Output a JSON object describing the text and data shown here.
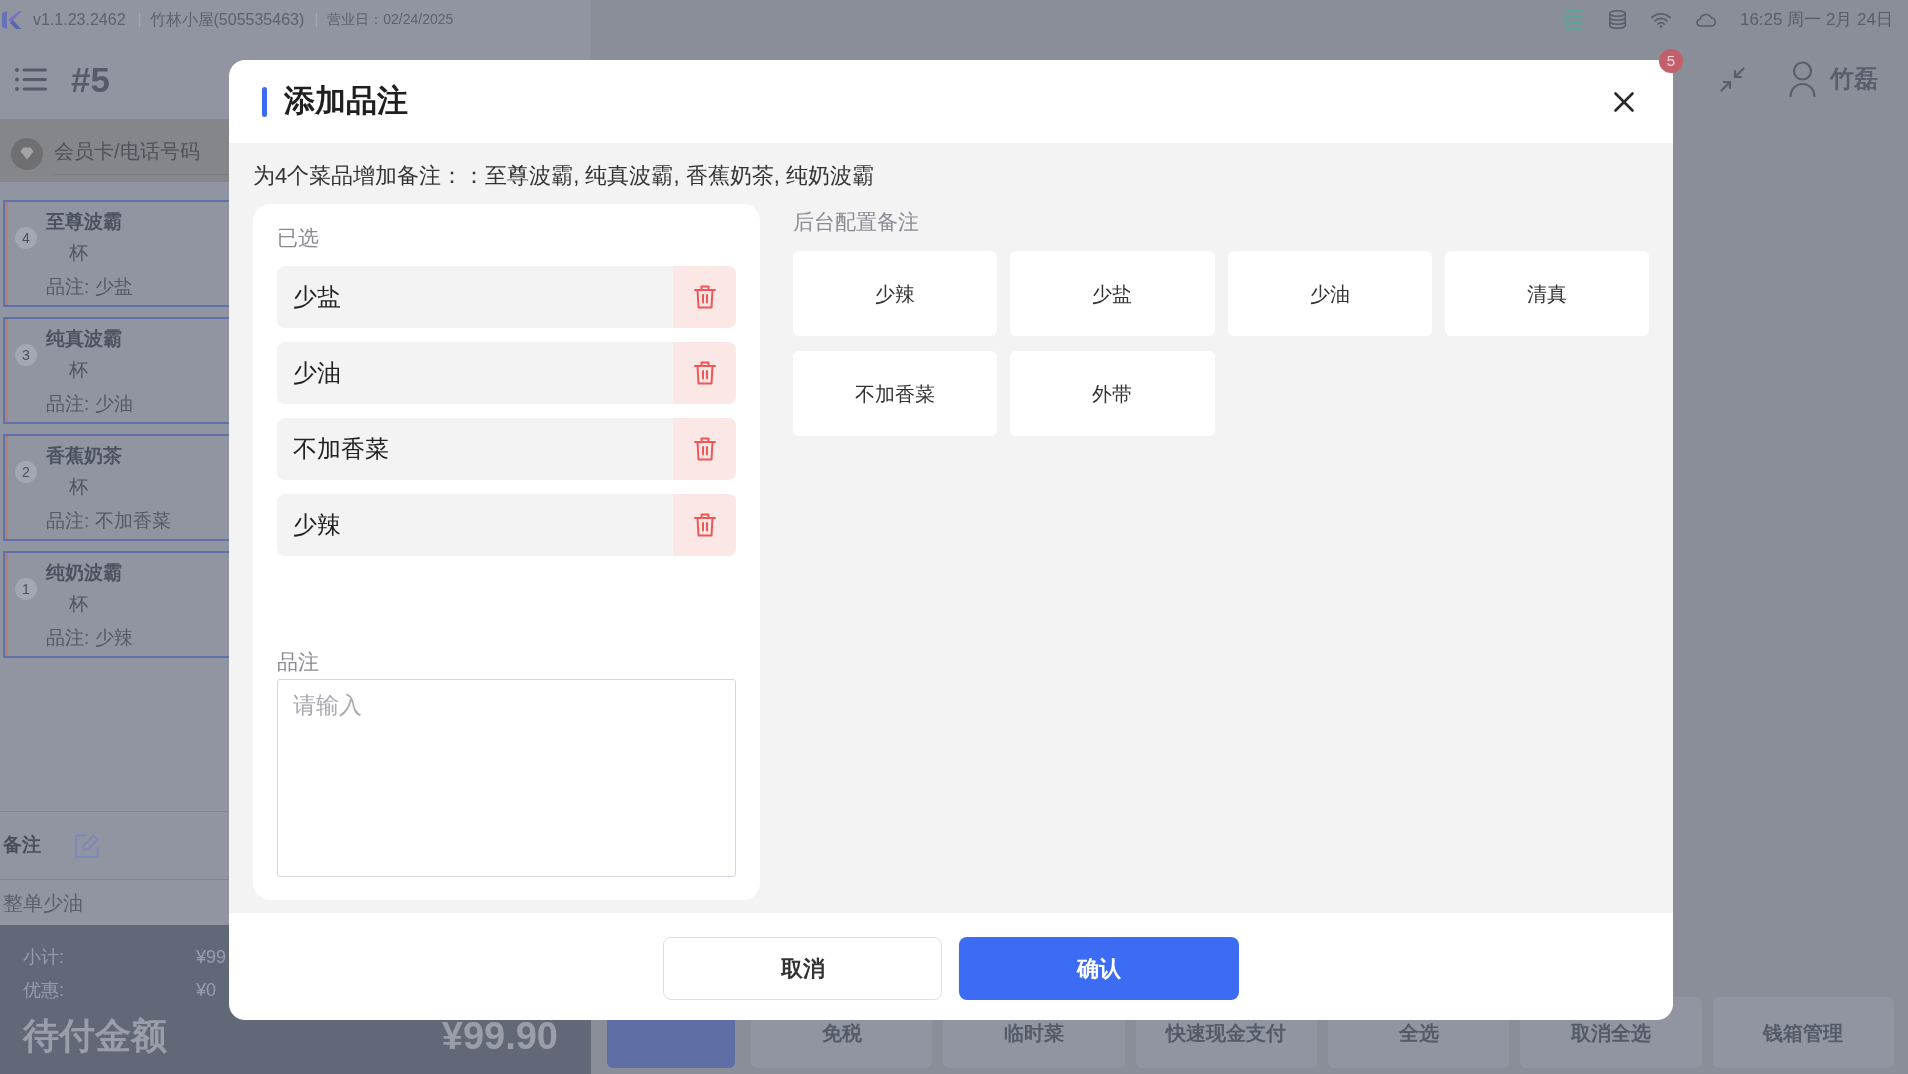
{
  "status_bar": {
    "version": "v1.1.23.2462",
    "store": "竹林小屋(505535463)",
    "business_date": "营业日：02/24/2025",
    "clock": "16:25 周一 2月 24日"
  },
  "header": {
    "order_number": "#5",
    "notification_count": "5",
    "user_name": "竹磊"
  },
  "member_search": {
    "placeholder": "会员卡/电话号码"
  },
  "order_items": [
    {
      "index": "4",
      "name": "至尊波霸",
      "unit": "杯",
      "note": "品注: 少盐",
      "selected": true
    },
    {
      "index": "3",
      "name": "纯真波霸",
      "unit": "杯",
      "note": "品注: 少油",
      "selected": true
    },
    {
      "index": "2",
      "name": "香蕉奶茶",
      "unit": "杯",
      "note": "品注: 不加香菜",
      "selected": true
    },
    {
      "index": "1",
      "name": "纯奶波霸",
      "unit": "杯",
      "note": "品注: 少辣",
      "selected": true
    }
  ],
  "order_note": {
    "label": "备注",
    "text": "整单少油"
  },
  "totals": {
    "lines": [
      {
        "label": "小计:",
        "value": "¥99"
      },
      {
        "label": "优惠:",
        "value": "¥0"
      }
    ],
    "due_label": "待付金额",
    "due_value": "¥99.90"
  },
  "action_buttons": [
    {
      "kind": "primary"
    },
    {
      "kind": "plain",
      "label": "免税"
    },
    {
      "kind": "plain",
      "label": "临时菜"
    },
    {
      "kind": "plain",
      "label": "快速现金支付"
    },
    {
      "kind": "plain",
      "label": "全选"
    },
    {
      "kind": "plain",
      "label": "取消全选"
    },
    {
      "kind": "plain",
      "label": "钱箱管理"
    }
  ],
  "dialog": {
    "title": "添加品注",
    "description": "为4个菜品增加备注：：至尊波霸, 纯真波霸, 香蕉奶茶, 纯奶波霸",
    "selected_label": "已选",
    "selected_notes": [
      "少盐",
      "少油",
      "不加香菜",
      "少辣"
    ],
    "note_field": {
      "label": "品注",
      "placeholder": "请输入"
    },
    "presets_label": "后台配置备注",
    "preset_notes": [
      "少辣",
      "少盐",
      "少油",
      "清真",
      "不加香菜",
      "外带"
    ],
    "buttons": [
      {
        "kind": "secondary",
        "label": "取消"
      },
      {
        "kind": "primary",
        "label": "确认"
      }
    ]
  }
}
